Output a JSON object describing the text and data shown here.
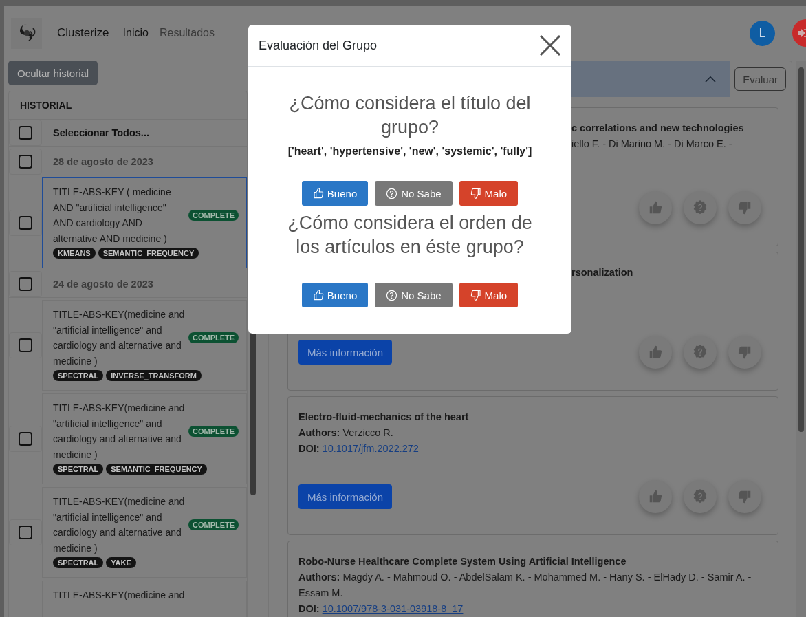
{
  "navbar": {
    "brand": "Clusterize",
    "links": [
      {
        "label": "Inicio",
        "selected": true
      },
      {
        "label": "Resultados",
        "selected": false
      }
    ],
    "avatar": "L"
  },
  "sidebar": {
    "toggle_button": "Ocultar historial",
    "title": "HISTORIAL",
    "select_all": {
      "label": "Seleccionar Todos...",
      "checked": false
    },
    "groups": [
      {
        "date": "28 de agosto de 2023",
        "checked": false,
        "entries": [
          {
            "query": "TITLE-ABS-KEY ( medicine AND \"artificial intelligence\" AND cardiology AND alternative AND medicine )",
            "status": "COMPLETE",
            "tags": [
              "KMEANS",
              "SEMANTIC_FREQUENCY"
            ],
            "checked": false,
            "selected": true
          }
        ]
      },
      {
        "date": "24 de agosto de 2023",
        "checked": false,
        "entries": [
          {
            "query": "TITLE-ABS-KEY(medicine and \"artificial intelligence\" and cardiology and alternative and medicine )",
            "status": "COMPLETE",
            "tags": [
              "SPECTRAL",
              "INVERSE_TRANSFORM"
            ],
            "checked": false,
            "selected": false
          },
          {
            "query": "TITLE-ABS-KEY(medicine and \"artificial intelligence\" and cardiology and alternative and medicine )",
            "status": "COMPLETE",
            "tags": [
              "SPECTRAL",
              "SEMANTIC_FREQUENCY"
            ],
            "checked": false,
            "selected": false
          },
          {
            "query": "TITLE-ABS-KEY(medicine and \"artificial intelligence\" and cardiology and alternative and medicine )",
            "status": "COMPLETE",
            "tags": [
              "SPECTRAL",
              "YAKE"
            ],
            "checked": false,
            "selected": false
          },
          {
            "query": "TITLE-ABS-KEY(medicine and",
            "selected": false
          }
        ]
      }
    ]
  },
  "results": {
    "evaluate_button": "Evaluar",
    "expanded": true,
    "articles": [
      {
        "kind": "covered",
        "title": "c correlations and new technologies",
        "authors": "iello F. - Di Marino M. - Di Marco E. -",
        "rating_buttons": true
      },
      {
        "kind": "covered",
        "title": "rsonalization",
        "more_button": "Más información",
        "rating_buttons": true
      },
      {
        "kind": "full",
        "title": "Electro-fluid-mechanics of the heart",
        "authors_label": "Authors:",
        "authors": "Verzicco R.",
        "doi_label": "DOI:",
        "doi": "10.1017/jfm.2022.272",
        "more_button": "Más información",
        "rating_buttons": true
      },
      {
        "kind": "full",
        "title": "Robo-Nurse Healthcare Complete System Using Artificial Intelligence",
        "authors_label": "Authors:",
        "authors": "Magdy A. - Mahmoud O. - AbdelSalam K. - Mohammed M. - Hany S. - ElHady D. - Samir A. - Essam M.",
        "doi_label": "DOI:",
        "doi": "10.1007/978-3-031-03918-8_17"
      }
    ]
  },
  "modal": {
    "title": "Evaluación del Grupo",
    "questions": [
      {
        "question": "¿Cómo considera el título del grupo?",
        "keywords": "['heart', 'hypertensive', 'new', 'systemic', 'fully']",
        "options": [
          {
            "kind": "good",
            "label": "Bueno"
          },
          {
            "kind": "unknown",
            "label": "No Sabe"
          },
          {
            "kind": "bad",
            "label": "Malo"
          }
        ]
      },
      {
        "question": "¿Cómo considera el orden de los artículos en éste grupo?",
        "options": [
          {
            "kind": "good",
            "label": "Bueno"
          },
          {
            "kind": "unknown",
            "label": "No Sabe"
          },
          {
            "kind": "bad",
            "label": "Malo"
          }
        ]
      }
    ]
  }
}
